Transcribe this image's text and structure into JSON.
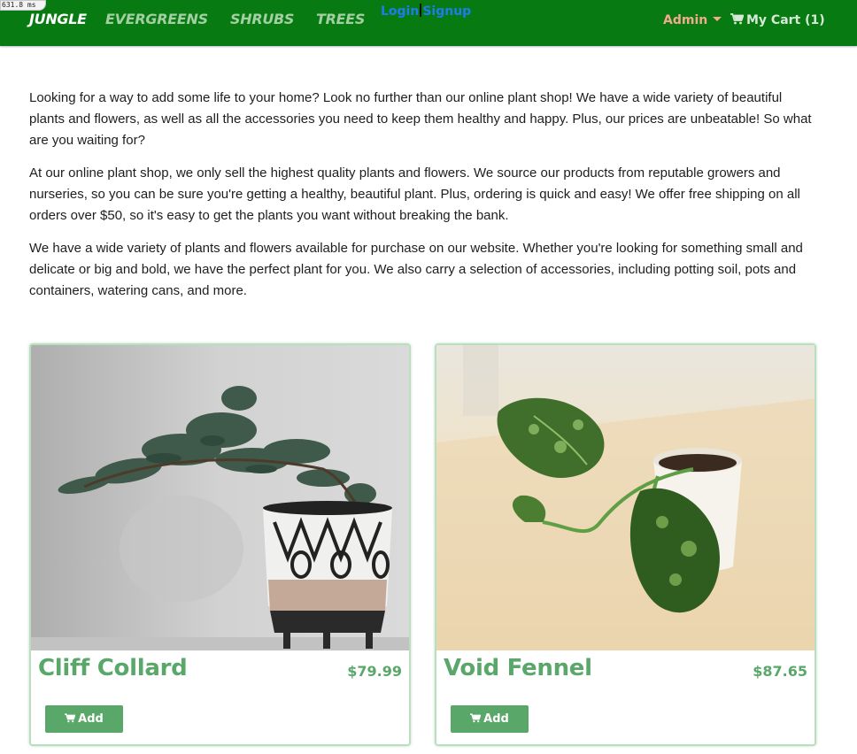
{
  "timing": "631.8 ms",
  "nav": {
    "brand": "JUNGLE",
    "links": [
      "EVERGREENS",
      "SHRUBS",
      "TREES"
    ],
    "login": "Login",
    "signup": "Signup",
    "admin": "Admin",
    "cart": "My Cart (1)"
  },
  "intro": {
    "paragraphs": [
      "Looking for a way to add some life to your home? Look no further than our online plant shop! We have a wide variety of beautiful plants and flowers, as well as all the accessories you need to keep them healthy and happy. Plus, our prices are unbeatable! So what are you waiting for?",
      "At our online plant shop, we only sell the highest quality plants and flowers. We source our products from reputable growers and nurseries, so you can be sure you're getting a healthy, beautiful plant. Plus, ordering is quick and easy! We offer free shipping on all orders over $50, so it's easy to get the plants you want without breaking the bank.",
      "We have a wide variety of plants and flowers available for purchase on our website. Whether you're looking for something small and delicate or big and bold, we have the perfect plant for you. We also carry a selection of accessories, including potting soil, pots and containers, watering cans, and more."
    ]
  },
  "products": [
    {
      "name": "Cliff Collard",
      "price": "$79.99",
      "add_label": "Add"
    },
    {
      "name": "Void Fennel",
      "price": "$87.65",
      "add_label": "Add"
    }
  ],
  "colors": {
    "navbar": "#087a12",
    "brand_text": "#ffffff",
    "nav_link": "#a3cfa3",
    "auth_link": "#1e7cf0",
    "admin": "#f2ab8c",
    "accent_green": "#5aa76a",
    "card_border": "#b9dfbe"
  },
  "icons": {
    "cart": "shopping-cart-icon",
    "admin_caret": "caret-down-icon"
  }
}
